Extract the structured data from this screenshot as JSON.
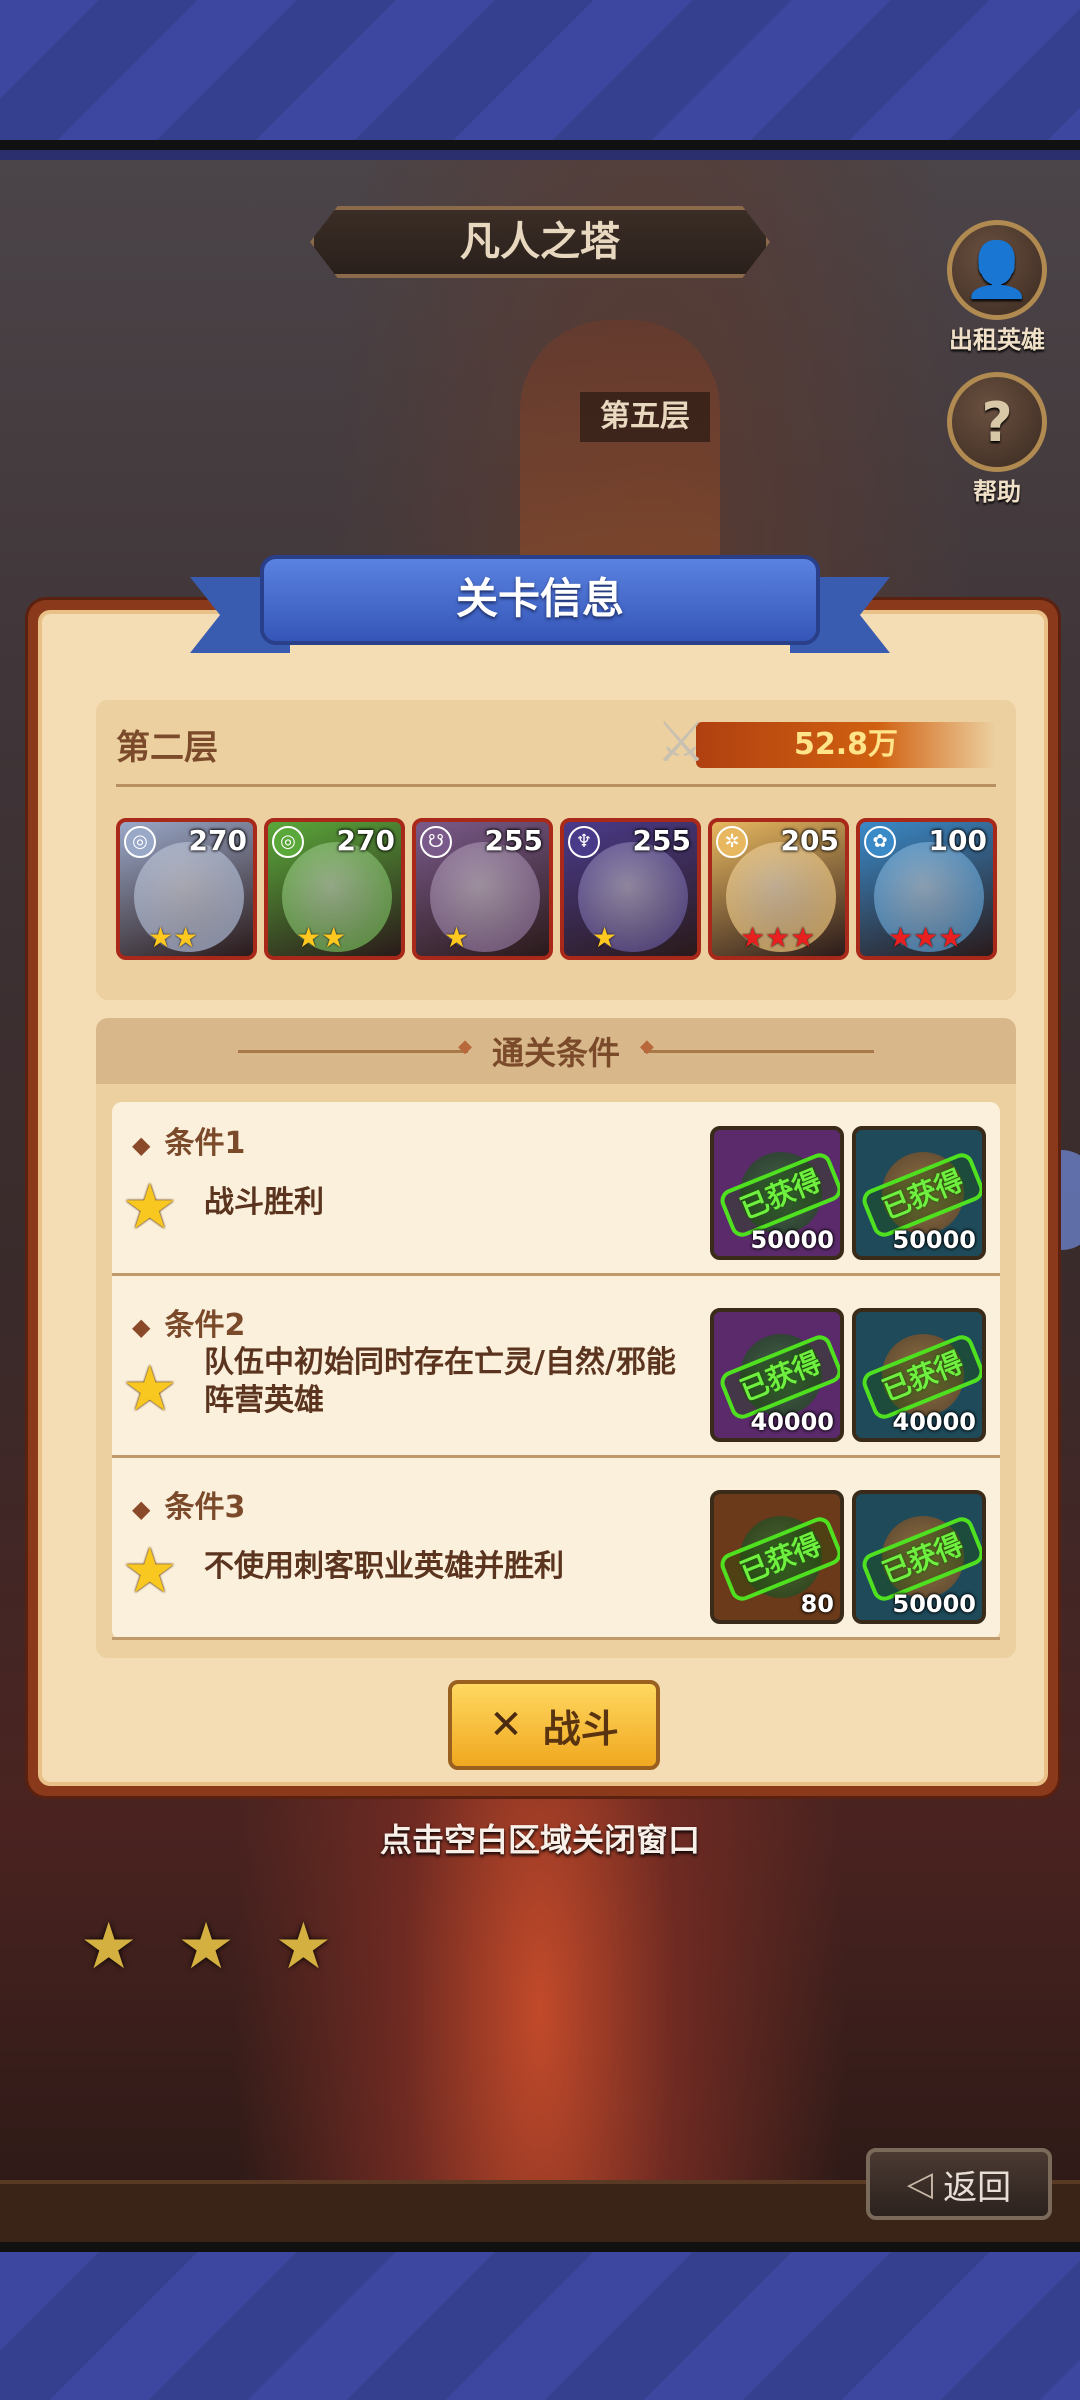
{
  "scene": {
    "title": "凡人之塔",
    "floor_label": "第五层",
    "rent_hero_label": "出租英雄",
    "help_label": "帮助",
    "back_label": "返回",
    "close_hint": "点击空白区域关闭窗口"
  },
  "dialog": {
    "title": "关卡信息",
    "layer_name": "第二层",
    "power": "52.8万",
    "heroes": [
      {
        "level": "270",
        "stars": 2,
        "star_color": "gold",
        "color": "#9aa8c8"
      },
      {
        "level": "270",
        "stars": 2,
        "star_color": "gold",
        "color": "#5aa83a"
      },
      {
        "level": "255",
        "stars": 1,
        "star_color": "gold",
        "color": "#7a5a8a"
      },
      {
        "level": "255",
        "stars": 1,
        "star_color": "gold",
        "color": "#4a3a8a"
      },
      {
        "level": "205",
        "stars": 3,
        "star_color": "red",
        "color": "#e8b860"
      },
      {
        "level": "100",
        "stars": 3,
        "star_color": "red",
        "color": "#3a8ac8"
      }
    ],
    "conditions_header": "通关条件",
    "conditions": [
      {
        "name": "条件1",
        "text": "战斗胜利",
        "rewards": [
          {
            "status": "已获得",
            "amount": "50000",
            "bg": "#5a2a6a"
          },
          {
            "status": "已获得",
            "amount": "50000",
            "bg": "#1e4a5a"
          }
        ]
      },
      {
        "name": "条件2",
        "text": "队伍中初始同时存在亡灵/自然/邪能阵营英雄",
        "rewards": [
          {
            "status": "已获得",
            "amount": "40000",
            "bg": "#5a2a6a"
          },
          {
            "status": "已获得",
            "amount": "40000",
            "bg": "#1e4a5a"
          }
        ]
      },
      {
        "name": "条件3",
        "text": "不使用刺客职业英雄并胜利",
        "rewards": [
          {
            "status": "已获得",
            "amount": "80",
            "bg": "#6a3a1a"
          },
          {
            "status": "已获得",
            "amount": "50000",
            "bg": "#1e4a5a"
          }
        ]
      }
    ],
    "fight_label": "战斗"
  },
  "bottom_stars": 3
}
